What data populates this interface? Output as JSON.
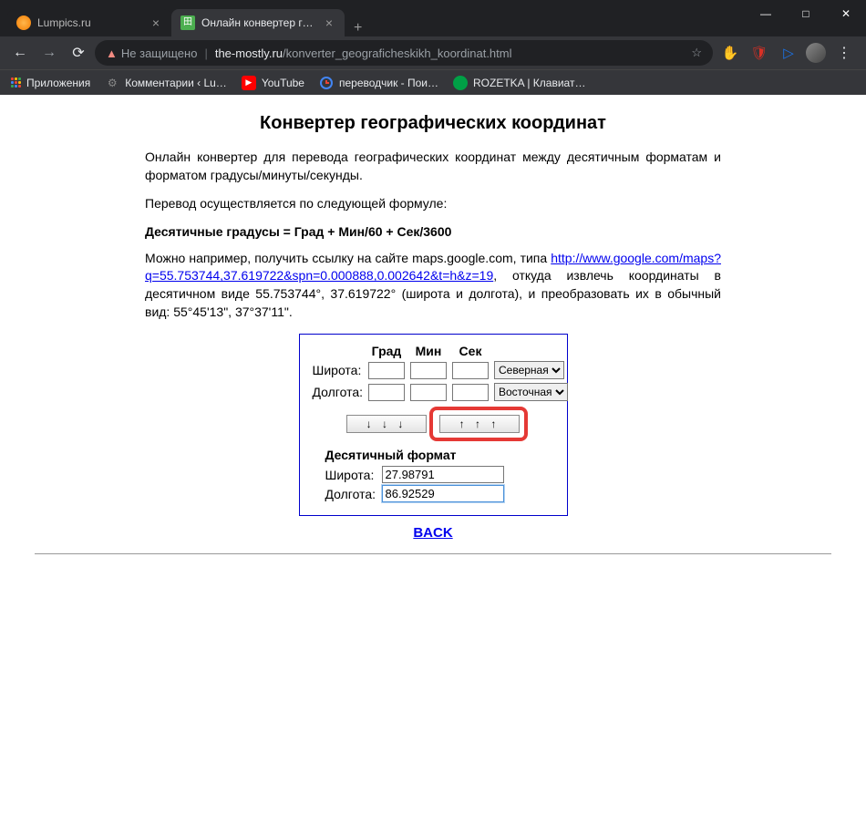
{
  "window": {
    "minimize": "—",
    "maximize": "□",
    "close": "✕"
  },
  "tabs": [
    {
      "title": "Lumpics.ru",
      "active": false
    },
    {
      "title": "Онлайн конвертер географичес",
      "active": true
    }
  ],
  "nav": {
    "back": "←",
    "forward": "→",
    "reload": "⟳"
  },
  "omnibox": {
    "warning_icon": "▲",
    "warning_text": "Не защищено",
    "host": "the-mostly.ru",
    "path": "/konverter_geograficheskikh_koordinat.html",
    "star": "☆"
  },
  "extensions": {
    "hand": "✋",
    "shield": "🛡",
    "play": "▷"
  },
  "bookmarks": [
    {
      "label": "Приложения",
      "icon": "apps"
    },
    {
      "label": "Комментарии ‹ Lu…",
      "icon": "gear"
    },
    {
      "label": "YouTube",
      "icon": "yt"
    },
    {
      "label": "переводчик - Пои…",
      "icon": "g"
    },
    {
      "label": "ROZETKA | Клавиат…",
      "icon": "roz"
    }
  ],
  "page": {
    "h1": "Конвертер географических координат",
    "p1": "Онлайн конвертер для перевода географических координат между десятичным форматам и форматом градусы/минуты/секунды.",
    "p2": "Перевод осуществляется по следующей формуле:",
    "formula": "Десятичные градусы = Град + Мин/60 + Сек/3600",
    "p3a": "Можно например, получить ссылку на сайте maps.google.com, типа ",
    "p3link": "http://www.google.com/maps?q=55.753744,37.619722&spn=0.000888,0.002642&t=h&z=19",
    "p3b": ", откуда извлечь координаты в десятичном виде 55.753744°, 37.619722° (широта и долгота), и преобразовать их в обычный вид: 55°45'13\", 37°37'11\".",
    "back": "BACK"
  },
  "converter": {
    "headers": {
      "grad": "Град",
      "min": "Мин",
      "sec": "Сек"
    },
    "lat_label": "Широта:",
    "lon_label": "Долгота:",
    "lat_dir": "Северная",
    "lon_dir": "Восточная",
    "btn_down": "↓ ↓ ↓",
    "btn_up": "↑ ↑ ↑",
    "dec_header": "Десятичный формат",
    "dec_lat_label": "Широта:",
    "dec_lon_label": "Долгота:",
    "dec_lat": "27.98791",
    "dec_lon": "86.92529",
    "dms": {
      "lat_grad": "",
      "lat_min": "",
      "lat_sec": "",
      "lon_grad": "",
      "lon_min": "",
      "lon_sec": ""
    }
  }
}
